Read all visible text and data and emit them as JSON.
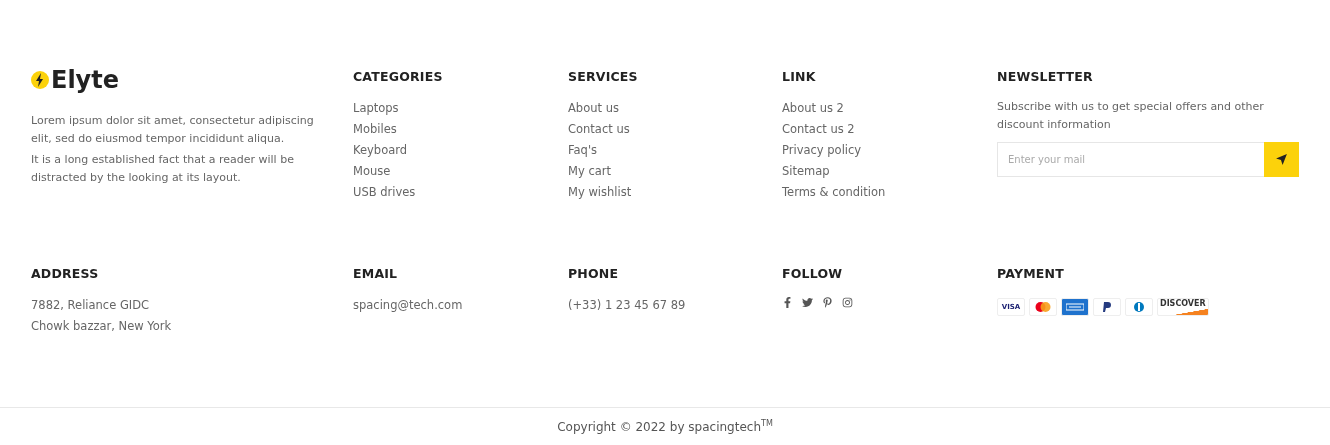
{
  "brand": {
    "name": "Elyte",
    "paragraphs": [
      "Lorem ipsum dolor sit amet, consectetur adipiscing elit, sed do eiusmod tempor incididunt aliqua.",
      "It is a long established fact that a reader will be distracted by the looking at its layout."
    ]
  },
  "link_columns": [
    {
      "title": "CATEGORIES",
      "links": [
        "Laptops",
        "Mobiles",
        "Keyboard",
        "Mouse",
        "USB drives"
      ]
    },
    {
      "title": "SERVICES",
      "links": [
        "About us",
        "Contact us",
        "Faq's",
        "My cart",
        "My wishlist"
      ]
    },
    {
      "title": "LINK",
      "links": [
        "About us 2",
        "Contact us 2",
        "Privacy policy",
        "Sitemap",
        "Terms & condition"
      ]
    }
  ],
  "newsletter": {
    "title": "NEWSLETTER",
    "text": "Subscribe with us to get special offers and other discount information",
    "placeholder": "Enter your mail"
  },
  "address": {
    "title": "ADDRESS",
    "lines": [
      "7882, Reliance GIDC",
      "Chowk bazzar, New York"
    ]
  },
  "email": {
    "title": "EMAIL",
    "value": "spacing@tech.com"
  },
  "phone": {
    "title": "PHONE",
    "value": "(+33) 1 23 45 67 89"
  },
  "follow": {
    "title": "FOLLOW",
    "networks": [
      {
        "kind": "facebook"
      },
      {
        "kind": "twitter"
      },
      {
        "kind": "pinterest"
      },
      {
        "kind": "instagram"
      }
    ]
  },
  "payment": {
    "title": "PAYMENT",
    "cards": [
      {
        "kind": "visa",
        "label": "VISA"
      },
      {
        "kind": "mastercard"
      },
      {
        "kind": "amex"
      },
      {
        "kind": "paypal"
      },
      {
        "kind": "diners"
      },
      {
        "kind": "discover",
        "label": "DISCOVER"
      }
    ]
  },
  "copyright": "Copyright © 2022 by spacingtech$^{TM}$"
}
